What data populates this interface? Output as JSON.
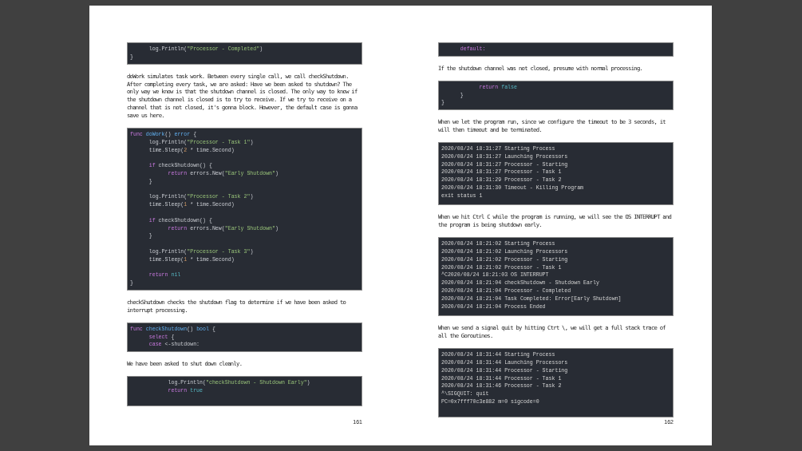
{
  "pages": [
    {
      "page_number": "161",
      "blocks": [
        {
          "kind": "code",
          "groups": [
            [
              {
                "tokens": [
                  {
                    "kind": "plain",
                    "text": "      log.Println("
                  },
                  {
                    "kind": "string",
                    "text": "\"Processor - Completed\""
                  },
                  {
                    "kind": "plain",
                    "text": ")"
                  }
                ]
              },
              {
                "tokens": [
                  {
                    "kind": "plain",
                    "text": "}"
                  }
                ]
              }
            ]
          ]
        },
        {
          "kind": "text",
          "text": "doWork simulates task work. Between every single call, we call checkShutdown. After completing every task, we are asked: Have we been asked to shutdown? The only way we know is that the shutdown channel is closed. The only way to know if the shutdown channel is closed is to try to receive. If we try to receive on a channel that is not closed, it's gonna block. However, the default case is gonna save us here."
        },
        {
          "kind": "code",
          "groups": [
            [
              {
                "tokens": [
                  {
                    "kind": "keyword",
                    "text": "func "
                  },
                  {
                    "kind": "function",
                    "text": "doWork"
                  },
                  {
                    "kind": "plain",
                    "text": "() "
                  },
                  {
                    "kind": "type",
                    "text": "error"
                  },
                  {
                    "kind": "plain",
                    "text": " {"
                  }
                ]
              },
              {
                "tokens": [
                  {
                    "kind": "plain",
                    "text": "      log.Println("
                  },
                  {
                    "kind": "string",
                    "text": "\"Processor - Task 1\""
                  },
                  {
                    "kind": "plain",
                    "text": ")"
                  }
                ]
              },
              {
                "tokens": [
                  {
                    "kind": "plain",
                    "text": "      time.Sleep("
                  },
                  {
                    "kind": "number",
                    "text": "2"
                  },
                  {
                    "kind": "plain",
                    "text": " * time.Second)"
                  }
                ]
              }
            ],
            [
              {
                "tokens": [
                  {
                    "kind": "keyword",
                    "text": "      if"
                  },
                  {
                    "kind": "plain",
                    "text": " checkShutdown() {"
                  }
                ]
              },
              {
                "tokens": [
                  {
                    "kind": "keyword",
                    "text": "            return"
                  },
                  {
                    "kind": "plain",
                    "text": " errors.New("
                  },
                  {
                    "kind": "string",
                    "text": "\"Early Shutdown\""
                  },
                  {
                    "kind": "plain",
                    "text": ")"
                  }
                ]
              },
              {
                "tokens": [
                  {
                    "kind": "plain",
                    "text": "      }"
                  }
                ]
              }
            ],
            [
              {
                "tokens": [
                  {
                    "kind": "plain",
                    "text": "      log.Println("
                  },
                  {
                    "kind": "string",
                    "text": "\"Processor - Task 2\""
                  },
                  {
                    "kind": "plain",
                    "text": ")"
                  }
                ]
              },
              {
                "tokens": [
                  {
                    "kind": "plain",
                    "text": "      time.Sleep("
                  },
                  {
                    "kind": "number",
                    "text": "1"
                  },
                  {
                    "kind": "plain",
                    "text": " * time.Second)"
                  }
                ]
              }
            ],
            [
              {
                "tokens": [
                  {
                    "kind": "keyword",
                    "text": "      if"
                  },
                  {
                    "kind": "plain",
                    "text": " checkShutdown() {"
                  }
                ]
              },
              {
                "tokens": [
                  {
                    "kind": "keyword",
                    "text": "            return"
                  },
                  {
                    "kind": "plain",
                    "text": " errors.New("
                  },
                  {
                    "kind": "string",
                    "text": "\"Early Shutdown\""
                  },
                  {
                    "kind": "plain",
                    "text": ")"
                  }
                ]
              },
              {
                "tokens": [
                  {
                    "kind": "plain",
                    "text": "      }"
                  }
                ]
              }
            ],
            [
              {
                "tokens": [
                  {
                    "kind": "plain",
                    "text": "      log.Println("
                  },
                  {
                    "kind": "string",
                    "text": "\"Processor - Task 3\""
                  },
                  {
                    "kind": "plain",
                    "text": ")"
                  }
                ]
              },
              {
                "tokens": [
                  {
                    "kind": "plain",
                    "text": "      time.Sleep("
                  },
                  {
                    "kind": "number",
                    "text": "1"
                  },
                  {
                    "kind": "plain",
                    "text": " * time.Second)"
                  }
                ]
              }
            ],
            [
              {
                "tokens": [
                  {
                    "kind": "keyword",
                    "text": "      return "
                  },
                  {
                    "kind": "constant",
                    "text": "nil"
                  }
                ]
              },
              {
                "tokens": [
                  {
                    "kind": "plain",
                    "text": "}"
                  }
                ]
              }
            ]
          ]
        },
        {
          "kind": "text",
          "text": "checkShutdown checks the shutdown flag to determine if we have been asked to interrupt processing."
        },
        {
          "kind": "code",
          "groups": [
            [
              {
                "tokens": [
                  {
                    "kind": "keyword",
                    "text": "func "
                  },
                  {
                    "kind": "function",
                    "text": "checkShutdown"
                  },
                  {
                    "kind": "plain",
                    "text": "() "
                  },
                  {
                    "kind": "type",
                    "text": "bool"
                  },
                  {
                    "kind": "plain",
                    "text": " {"
                  }
                ]
              },
              {
                "tokens": [
                  {
                    "kind": "keyword",
                    "text": "      select"
                  },
                  {
                    "kind": "plain",
                    "text": " {"
                  }
                ]
              },
              {
                "tokens": [
                  {
                    "kind": "keyword",
                    "text": "      case"
                  },
                  {
                    "kind": "plain",
                    "text": " <-shutdown:"
                  }
                ]
              }
            ]
          ]
        },
        {
          "kind": "text",
          "text": "We have been asked to shut down cleanly."
        },
        {
          "kind": "code",
          "groups": [
            [
              {
                "tokens": [
                  {
                    "kind": "plain",
                    "text": "            log.Println("
                  },
                  {
                    "kind": "string",
                    "text": "\"checkShutdown - Shutdown Early\""
                  },
                  {
                    "kind": "plain",
                    "text": ")"
                  }
                ]
              },
              {
                "tokens": [
                  {
                    "kind": "keyword",
                    "text": "            return "
                  },
                  {
                    "kind": "constant",
                    "text": "true"
                  }
                ]
              }
            ]
          ]
        }
      ]
    },
    {
      "page_number": "162",
      "blocks": [
        {
          "kind": "code",
          "groups": [
            [
              {
                "tokens": [
                  {
                    "kind": "keyword",
                    "text": "      default:"
                  }
                ]
              }
            ]
          ]
        },
        {
          "kind": "text",
          "text": "If the shutdown channel was not closed, presume with normal processing."
        },
        {
          "kind": "code",
          "groups": [
            [
              {
                "tokens": [
                  {
                    "kind": "keyword",
                    "text": "            return "
                  },
                  {
                    "kind": "constant",
                    "text": "false"
                  }
                ]
              },
              {
                "tokens": [
                  {
                    "kind": "plain",
                    "text": "      }"
                  }
                ]
              },
              {
                "tokens": [
                  {
                    "kind": "plain",
                    "text": "}"
                  }
                ]
              }
            ]
          ]
        },
        {
          "kind": "text",
          "text": "When we let the program run, since we configure the timeout to be 3 seconds, it will then timeout and be terminated."
        },
        {
          "kind": "output",
          "lines": [
            "2020/08/24 18:31:27 Starting Process",
            "2020/08/24 18:31:27 Launching Processors",
            "2020/08/24 18:31:27 Processor - Starting",
            "2020/08/24 18:31:27 Processor - Task 1",
            "2020/08/24 18:31:29 Processor - Task 2",
            "2020/08/24 18:31:30 Timeout - Killing Program",
            "exit status 1"
          ]
        },
        {
          "kind": "text",
          "text": "When we hit Ctrl C while the program is running, we will see the OS INTERRUPT and the program is being shutdown early."
        },
        {
          "kind": "output",
          "lines": [
            "2020/08/24 18:21:02 Starting Process",
            "2020/08/24 18:21:02 Launching Processors",
            "2020/08/24 18:21:02 Processor - Starting",
            "2020/08/24 18:21:02 Processor - Task 1",
            "^C2020/08/24 18:21:03 OS INTERRUPT",
            "2020/08/24 18:21:04 checkShutdown - Shutdown Early",
            "2020/08/24 18:21:04 Processor - Completed",
            "2020/08/24 18:21:04 Task Completed: Error[Early Shutdown]",
            "2020/08/24 18:21:04 Process Ended"
          ]
        },
        {
          "kind": "text",
          "text": "When we send a signal quit by hitting Ctrt \\, we will get a full stack trace of all the Goroutines."
        },
        {
          "kind": "output",
          "lines": [
            "2020/08/24 18:31:44 Starting Process",
            "2020/08/24 18:31:44 Launching Processors",
            "2020/08/24 18:31:44 Processor - Starting",
            "2020/08/24 18:31:44 Processor - Task 1",
            "2020/08/24 18:31:46 Processor - Task 2",
            "^\\SIGQUIT: quit",
            "PC=0x7fff70c3e882 m=0 sigcode=0"
          ]
        }
      ]
    }
  ]
}
